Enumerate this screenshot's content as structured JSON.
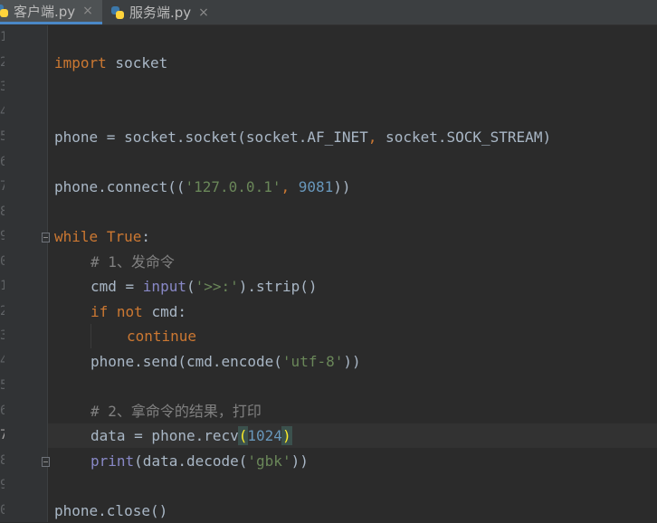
{
  "tabs": [
    {
      "label": "客户端.py",
      "active": true,
      "close": "×"
    },
    {
      "label": "服务端.py",
      "active": false,
      "close": "×"
    }
  ],
  "editor": {
    "current_line": 17,
    "line_numbers": [
      "1",
      "2",
      "3",
      "4",
      "5",
      "6",
      "7",
      "8",
      "9",
      "0",
      "1",
      "2",
      "3",
      "4",
      "5",
      "6",
      "7",
      "8",
      "9",
      "0",
      "1"
    ],
    "lines": {
      "l2": {
        "kw": "import",
        "rest": " socket"
      },
      "l5": {
        "a": "phone = socket.socket(socket.AF_INET",
        "comma": ",",
        "b": " socket.SOCK_STREAM)"
      },
      "l7": {
        "a": "phone.connect((",
        "str": "'127.0.0.1'",
        "comma": ",",
        "sp": " ",
        "num": "9081",
        "b": "))"
      },
      "l9": {
        "kw1": "while",
        "sp": " ",
        "kw2": "True",
        "b": ":"
      },
      "l10": {
        "cmt": "# 1、发命令"
      },
      "l11": {
        "a": "cmd = ",
        "builtin": "input",
        "b": "(",
        "str": "'>>:'",
        "c": ").strip()"
      },
      "l12": {
        "kw1": "if",
        "sp1": " ",
        "kw2": "not",
        "b": " cmd:"
      },
      "l13": {
        "kw": "continue"
      },
      "l14": {
        "a": "phone.send(cmd.encode(",
        "str": "'utf-8'",
        "b": "))"
      },
      "l16": {
        "cmt": "# 2、拿命令的结果，打印"
      },
      "l17": {
        "a": "data = phone.recv",
        "p1": "(",
        "num": "1024",
        "p2": ")"
      },
      "l18": {
        "builtin": "print",
        "a": "(data.decode(",
        "str": "'gbk'",
        "b": "))"
      },
      "l20": {
        "a": "phone.close()"
      }
    }
  },
  "colors": {
    "background": "#2b2b2b",
    "keyword": "#cc7832",
    "string": "#6a8759",
    "number": "#6897bb",
    "builtin": "#8888c6",
    "comment": "#808080",
    "text": "#a9b7c6"
  }
}
